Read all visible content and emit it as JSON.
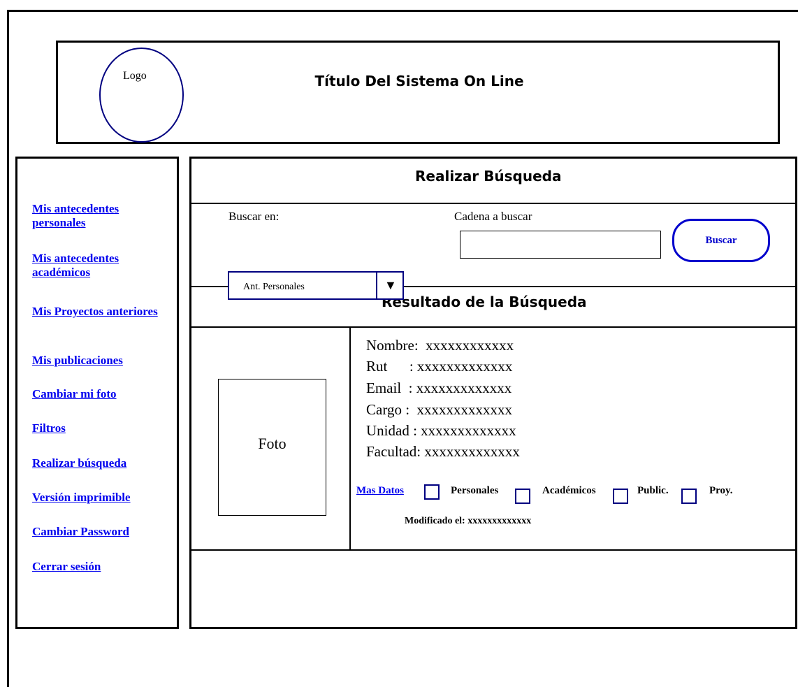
{
  "header": {
    "logo_label": "Logo",
    "title": "Título Del Sistema On Line"
  },
  "sidebar": {
    "items": [
      {
        "label": "Mis antecedentes personales"
      },
      {
        "label": "Mis antecedentes académicos"
      },
      {
        "label": "Mis Proyectos anteriores"
      },
      {
        "label": "Mis publicaciones"
      },
      {
        "label": "Cambiar mi foto"
      },
      {
        "label": "Filtros"
      },
      {
        "label": "Realizar búsqueda"
      },
      {
        "label": "Versión imprimible"
      },
      {
        "label": "Cambiar Password"
      },
      {
        "label": "Cerrar sesión"
      }
    ]
  },
  "search": {
    "title": "Realizar Búsqueda",
    "search_in_label": "Buscar en:",
    "query_label": "Cadena a buscar",
    "query_value": "",
    "button_label": "Buscar",
    "select_value": "Ant. Personales",
    "select_arrow": "▼"
  },
  "results": {
    "title": "Resultado de la Búsqueda",
    "photo_label": "Foto",
    "fields": [
      {
        "text": "Nombre:  xxxxxxxxxxxx"
      },
      {
        "text": "Rut      : xxxxxxxxxxxxx"
      },
      {
        "text": "Email  : xxxxxxxxxxxxx"
      },
      {
        "text": "Cargo :  xxxxxxxxxxxxx"
      },
      {
        "text": "Unidad : xxxxxxxxxxxxx"
      },
      {
        "text": "Facultad: xxxxxxxxxxxxx"
      }
    ],
    "more_data_label": "Mas Datos",
    "checkboxes": [
      {
        "label": "Personales",
        "checked": false
      },
      {
        "label": "Académicos",
        "checked": false
      },
      {
        "label": "Public.",
        "checked": false
      },
      {
        "label": "Proy.",
        "checked": false
      }
    ],
    "modified_text": "Modificado el: xxxxxxxxxxxxx"
  }
}
